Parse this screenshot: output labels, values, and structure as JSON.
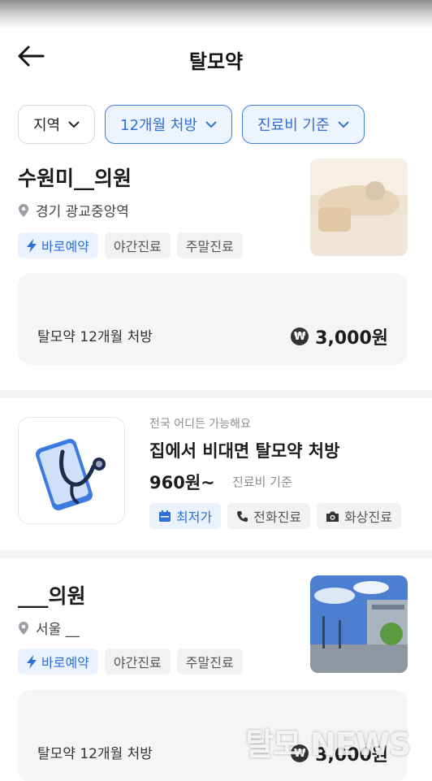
{
  "header": {
    "title": "탈모약"
  },
  "filters": [
    {
      "label": "지역",
      "active": false
    },
    {
      "label": "12개월 처방",
      "active": true
    },
    {
      "label": "진료비 기준",
      "active": true
    }
  ],
  "clinics": [
    {
      "name": "수원미__의원",
      "location": "경기 광교중앙역",
      "tags": [
        "바로예약",
        "야간진료",
        "주말진료"
      ],
      "price_label": "탈모약 12개월 처방",
      "price": "3,000원"
    },
    {
      "name": "___의원",
      "location": "서울 __",
      "tags": [
        "바로예약",
        "야간진료",
        "주말진료"
      ],
      "price_label": "탈모약 12개월 처방",
      "price": "3,000원"
    }
  ],
  "promo": {
    "subtitle": "전국 어디든 가능해요",
    "title": "집에서 비대면 탈모약 처방",
    "price": "960원~",
    "price_note": "진료비 기준",
    "tags": [
      "최저가",
      "전화진료",
      "화상진료"
    ]
  },
  "currency_badge": "₩",
  "watermark": "탈모 NEWS",
  "colors": {
    "accent": "#2f6fd6",
    "accent_bg": "#eef4fd",
    "card_bg": "#f4f5f7"
  },
  "icons": [
    "back-arrow-icon",
    "chevron-down-icon",
    "location-pin-icon",
    "lightning-icon",
    "calendar-icon",
    "phone-icon",
    "camera-icon",
    "won-icon",
    "stethoscope-phone-icon"
  ]
}
